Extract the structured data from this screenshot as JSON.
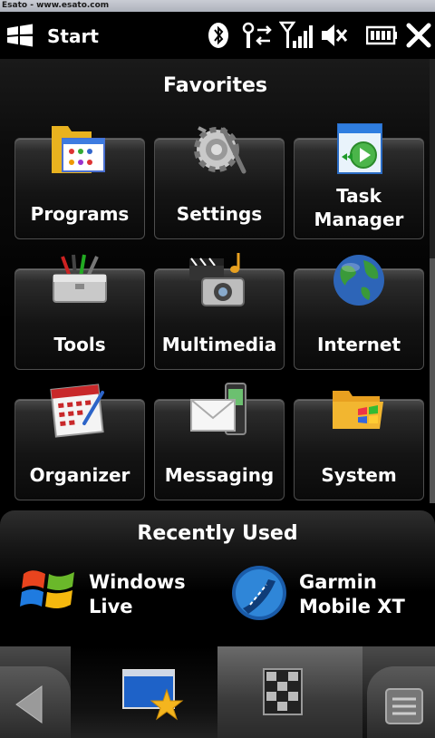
{
  "watermark": "Esato - www.esato.com",
  "statusbar": {
    "start_label": "Start",
    "icons": [
      "windows-flag-icon",
      "bluetooth-icon",
      "data-connection-icon",
      "signal-strength-icon",
      "volume-muted-icon",
      "battery-icon",
      "close-icon"
    ]
  },
  "favorites": {
    "title": "Favorites",
    "tiles": [
      {
        "label": "Programs",
        "icon": "programs-icon"
      },
      {
        "label": "Settings",
        "icon": "settings-icon"
      },
      {
        "label": "Task\nManager",
        "icon": "task-manager-icon"
      },
      {
        "label": "Tools",
        "icon": "tools-icon"
      },
      {
        "label": "Multimedia",
        "icon": "multimedia-icon"
      },
      {
        "label": "Internet",
        "icon": "internet-icon"
      },
      {
        "label": "Organizer",
        "icon": "organizer-icon"
      },
      {
        "label": "Messaging",
        "icon": "messaging-icon"
      },
      {
        "label": "System",
        "icon": "system-icon"
      }
    ]
  },
  "recent": {
    "title": "Recently Used",
    "items": [
      {
        "label": "Windows\nLive",
        "icon": "windows-live-icon"
      },
      {
        "label": "Garmin\nMobile XT",
        "icon": "garmin-icon"
      }
    ]
  },
  "bottombar": {
    "icons": [
      "back-arrow-icon",
      "favorites-tab-icon",
      "all-programs-tab-icon",
      "menu-icon"
    ]
  }
}
